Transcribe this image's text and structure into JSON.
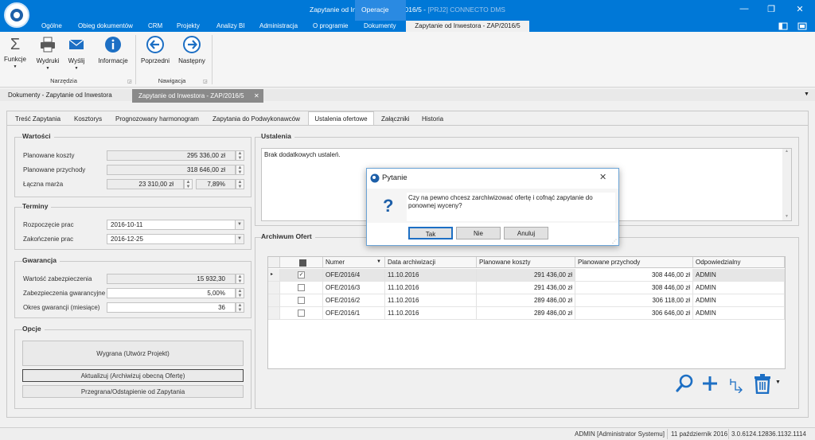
{
  "window": {
    "title_main": "Zapytanie od Inwestora - ZAP/2016/5 - ",
    "title_dim": "[PRJ2] CONNECTO DMS",
    "operations_label": "Operacje",
    "controls": [
      "—",
      "❐",
      "✕"
    ]
  },
  "menu": {
    "items": [
      "Ogólne",
      "Obieg dokumentów",
      "CRM",
      "Projekty",
      "Analizy BI",
      "Administracja",
      "O programie",
      "Dokumenty"
    ],
    "active": "Zapytanie od Inwestora - ZAP/2016/5"
  },
  "ribbon": {
    "groups": [
      {
        "label": "Narzędzia",
        "buttons": [
          "Funkcje",
          "Wydruki",
          "Wyślij",
          "Informacje"
        ]
      },
      {
        "label": "Nawigacja",
        "buttons": [
          "Poprzedni",
          "Następny"
        ]
      }
    ]
  },
  "doc_tabs": {
    "inactive": "Dokumenty - Zapytanie od Inwestora",
    "active": "Zapytanie od Inwestora - ZAP/2016/5",
    "close": "✕"
  },
  "tabs": {
    "items": [
      "Treść Zapytania",
      "Kosztorys",
      "Prognozowany harmonogram",
      "Zapytania do Podwykonawców",
      "Ustalenia ofertowe",
      "Załączniki",
      "Historia"
    ],
    "active_index": 4
  },
  "wartosci": {
    "title": "Wartości",
    "planowane_koszty_label": "Planowane koszty",
    "planowane_koszty": "295 336,00 zł",
    "planowane_przychody_label": "Planowane przychody",
    "planowane_przychody": "318 646,00 zł",
    "laczna_marza_label": "Łączna marża",
    "laczna_marza": "23 310,00 zł",
    "laczna_marza_pct": "7,89%"
  },
  "terminy": {
    "title": "Terminy",
    "rozpoczecie_label": "Rozpoczęcie prac",
    "rozpoczecie": "2016-10-11",
    "zakonczenie_label": "Zakończenie prac",
    "zakonczenie": "2016-12-25"
  },
  "gwarancja": {
    "title": "Gwarancja",
    "wartosc_label": "Wartość zabezpieczenia",
    "wartosc": "15 932,30",
    "zabezpieczenia_label": "Zabezpieczenia gwarancyjne",
    "zabezpieczenia": "5,00%",
    "okres_label": "Okres gwarancji (miesiące)",
    "okres": "36"
  },
  "opcje": {
    "title": "Opcje",
    "wygrana": "Wygrana (Utwórz Projekt)",
    "aktualizuj": "Aktualizuj (Archiwizuj obecną Ofertę)",
    "przegrana": "Przegrana/Odstąpienie od Zapytania"
  },
  "ustalenia": {
    "title": "Ustalenia",
    "text": "Brak dodatkowych ustaleń."
  },
  "archiwum": {
    "title": "Archiwum Ofert",
    "columns": [
      "Numer",
      "Data archiwizacji",
      "Planowane koszty",
      "Planowane przychody",
      "Odpowiedzialny"
    ],
    "rows": [
      {
        "checked": true,
        "numer": "OFE/2016/4",
        "data": "11.10.2016",
        "koszty": "291 436,00 zł",
        "przychody": "308 446,00 zł",
        "odp": "ADMIN"
      },
      {
        "checked": false,
        "numer": "OFE/2016/3",
        "data": "11.10.2016",
        "koszty": "291 436,00 zł",
        "przychody": "308 446,00 zł",
        "odp": "ADMIN"
      },
      {
        "checked": false,
        "numer": "OFE/2016/2",
        "data": "11.10.2016",
        "koszty": "289 486,00 zł",
        "przychody": "306 118,00 zł",
        "odp": "ADMIN"
      },
      {
        "checked": false,
        "numer": "OFE/2016/1",
        "data": "11.10.2016",
        "koszty": "289 486,00 zł",
        "przychody": "306 646,00 zł",
        "odp": "ADMIN"
      }
    ],
    "row_indicator": "▸",
    "tools": [
      "search-icon",
      "plus-icon",
      "undo-icon",
      "trash-icon"
    ]
  },
  "dialog": {
    "title": "Pytanie",
    "message": "Czy na pewno chcesz zarchiwizować ofertę i cofnąć zapytanie do ponownej wyceny?",
    "icon": "?",
    "close": "✕",
    "yes": "Tak",
    "no": "Nie",
    "cancel": "Anuluj"
  },
  "status": {
    "user": "ADMIN [Administrator Systemu]",
    "date": "11 październik 2016",
    "version": "3.0.6124.12836.1132.1114"
  },
  "colors": {
    "accent": "#0078d7",
    "icon_blue": "#1d6fc4"
  }
}
